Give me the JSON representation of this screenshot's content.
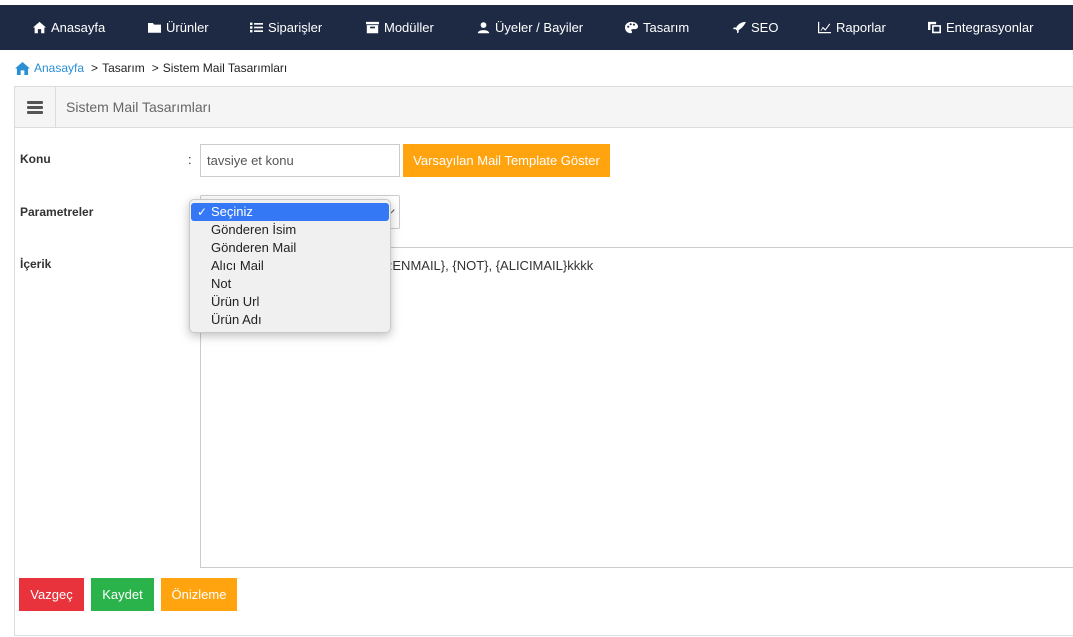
{
  "nav": {
    "items": [
      {
        "label": "Anasayfa",
        "icon": "home-icon"
      },
      {
        "label": "Ürünler",
        "icon": "folder-icon"
      },
      {
        "label": "Siparişler",
        "icon": "list-icon"
      },
      {
        "label": "Modüller",
        "icon": "module-box-icon"
      },
      {
        "label": "Üyeler / Bayiler",
        "icon": "users-icon"
      },
      {
        "label": "Tasarım",
        "icon": "palette-icon"
      },
      {
        "label": "SEO",
        "icon": "rocket-icon"
      },
      {
        "label": "Raporlar",
        "icon": "chart-icon"
      },
      {
        "label": "Entegrasyonlar",
        "icon": "clone-icon"
      }
    ]
  },
  "breadcrumb": {
    "home": "Anasayfa",
    "items": [
      "Tasarım",
      "Sistem Mail Tasarımları"
    ],
    "separator": ">"
  },
  "panel": {
    "title": "Sistem Mail Tasarımları"
  },
  "form": {
    "subject_label": "Konu",
    "colon": ":",
    "subject_value": "tavsiye et konu",
    "default_template_button": "Varsayılan Mail Template Göster",
    "params_label": "Parametreler",
    "content_label": "İçerik",
    "content_value": "RENMAIL}, {NOT}, {ALICIMAIL}kkkk"
  },
  "dropdown": {
    "selected": "Seçiniz",
    "check": "✓",
    "options": [
      "Seçiniz",
      "Gönderen İsim",
      "Gönderen Mail",
      "Alıcı Mail",
      "Not",
      "Ürün Url",
      "Ürün Adı"
    ]
  },
  "actions": {
    "cancel": "Vazgeç",
    "save": "Kaydet",
    "preview": "Önizleme"
  },
  "colors": {
    "nav_bg": "#1e2a44",
    "link": "#2b8fd6",
    "orange": "#ffa30f",
    "red": "#e8323c",
    "green": "#2bb34b",
    "select_highlight": "#3478f6"
  }
}
